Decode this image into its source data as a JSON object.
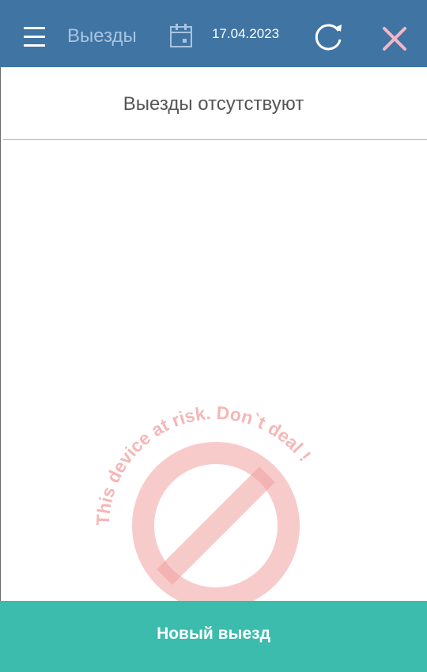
{
  "header": {
    "title": "Выезды",
    "date": "17.04.2023",
    "icons": {
      "menu": "menu-icon",
      "calendar": "calendar-icon",
      "refresh": "refresh-icon",
      "close": "close-icon"
    }
  },
  "main": {
    "empty_message": "Выезды отсутствуют"
  },
  "footer": {
    "new_button_label": "Новый выезд"
  },
  "watermark": {
    "text": "This device at risk. Don`t deal !",
    "icon": "prohibition-icon"
  },
  "colors": {
    "app_bar": "#3f74a3",
    "title": "#a8c4e2",
    "close_icon": "#f4b6c6",
    "button": "#3cbcad",
    "watermark": "#f2a0a0"
  }
}
